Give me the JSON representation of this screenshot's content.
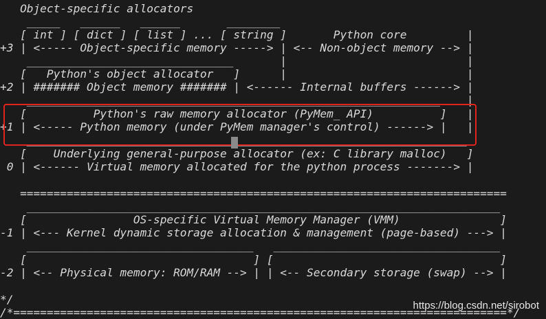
{
  "code_lines": [
    "   Object-specific allocators",
    "    _____   ______   ______       ________",
    "   [ int ] [ dict ] [ list ] ... [ string ]       Python core         |",
    "+3 | <----- Object-specific memory -----> | <-- Non-object memory --> |",
    "    _______________________________       |                           |",
    "   [   Python's object allocator   ]      |                           |",
    "+2 | ####### Object memory ####### | <------ Internal buffers ------> |",
    "    ______________________________________________________________    |",
    "   [          Python's raw memory allocator (PyMem_ API)          ]   |",
    "+1 | <----- Python memory (under PyMem manager's control) ------> |   |",
    "    __________________________________________________________________",
    "   [    Underlying general-purpose allocator (ex: C library malloc)   ]",
    " 0 | <------ Virtual memory allocated for the python process -------> |",
    "",
    "   =========================================================================",
    "    _______________________________________________________________________",
    "   [                OS-specific Virtual Memory Manager (VMM)               ]",
    "-1 | <--- Kernel dynamic storage allocation & management (page-based) ---> |",
    "    __________________________________   __________________________________",
    "   [                                  ] [                                  ]",
    "-2 | <-- Physical memory: ROM/RAM --> | | <-- Secondary storage (swap) --> |",
    "",
    "*/",
    "/*==========================================================================*/"
  ],
  "watermark": "https://blog.csdn.net/sirobot",
  "colors": {
    "background": "#1b1b1b",
    "text": "#d9d9d9",
    "highlight": "#e0231c",
    "cursor": "#8a8a8a"
  }
}
